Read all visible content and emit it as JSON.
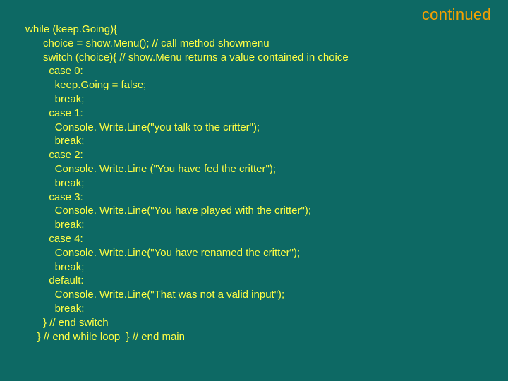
{
  "header": "continued",
  "code": {
    "l01": "while (keep.Going){",
    "l02": "      choice = show.Menu(); // call method showmenu",
    "l03": "      switch (choice){ // show.Menu returns a value contained in choice",
    "l04": "        case 0:",
    "l05": "          keep.Going = false;",
    "l06": "          break;",
    "l07": "        case 1:",
    "l08": "          Console. Write.Line(\"you talk to the critter\");",
    "l09": "          break;",
    "l10": "        case 2:",
    "l11": "          Console. Write.Line (\"You have fed the critter\");",
    "l12": "          break;",
    "l13": "        case 3:",
    "l14": "          Console. Write.Line(\"You have played with the critter\");",
    "l15": "          break;",
    "l16": "        case 4:",
    "l17": "          Console. Write.Line(\"You have renamed the critter\");",
    "l18": "          break;",
    "l19": "        default:",
    "l20": "          Console. Write.Line(\"That was not a valid input\");",
    "l21": "          break;",
    "l22": "      } // end switch",
    "l23": "    } // end while loop  } // end main"
  }
}
